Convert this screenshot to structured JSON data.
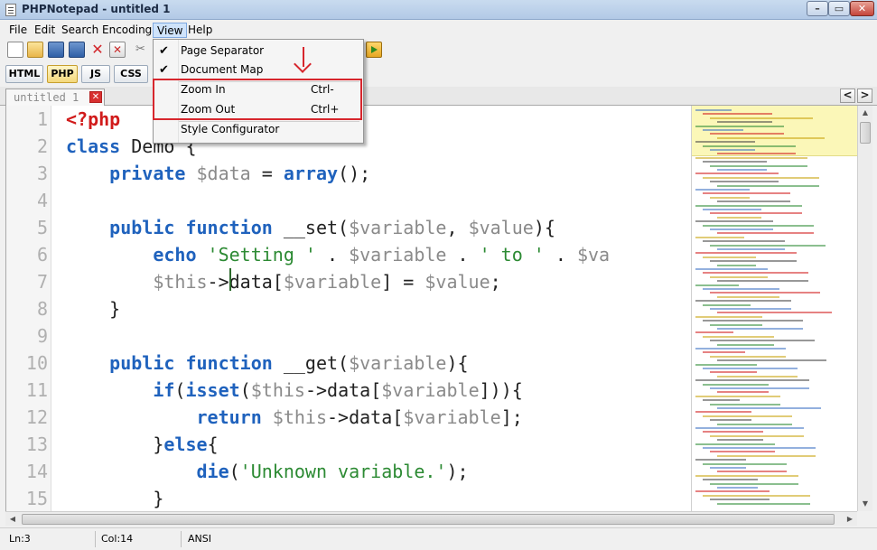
{
  "window": {
    "title": "PHPNotepad - untitled 1",
    "minimize": "–",
    "maximize": "▭",
    "close": "✕"
  },
  "menubar": [
    "File",
    "Edit",
    "Search",
    "Encoding",
    "View",
    "Help"
  ],
  "toolbar_icons": [
    "new-file-icon",
    "open-folder-icon",
    "save-icon",
    "save-all-icon",
    "close-icon",
    "close-all-icon",
    "cut-icon",
    "run-icon"
  ],
  "lang_tabs": [
    "HTML",
    "PHP",
    "JS",
    "CSS"
  ],
  "active_lang": "PHP",
  "doc_tab": {
    "label": "untitled 1",
    "close": "✕"
  },
  "tab_nav": {
    "prev": "<",
    "next": ">"
  },
  "line_numbers": [
    "1",
    "2",
    "3",
    "4",
    "5",
    "6",
    "7",
    "8",
    "9",
    "10",
    "11",
    "12",
    "13",
    "14",
    "15"
  ],
  "code_lines": [
    [
      {
        "t": "<?php",
        "c": "tag"
      }
    ],
    [
      {
        "t": "class",
        "c": "kw"
      },
      {
        "t": " Demo {",
        "c": ""
      }
    ],
    [
      {
        "t": "    ",
        "c": ""
      },
      {
        "t": "private",
        "c": "kw"
      },
      {
        "t": " ",
        "c": ""
      },
      {
        "t": "$data",
        "c": "var"
      },
      {
        "t": " = ",
        "c": ""
      },
      {
        "t": "array",
        "c": "kw"
      },
      {
        "t": "();",
        "c": ""
      }
    ],
    [],
    [
      {
        "t": "    ",
        "c": ""
      },
      {
        "t": "public",
        "c": "kw"
      },
      {
        "t": " ",
        "c": ""
      },
      {
        "t": "function",
        "c": "kw"
      },
      {
        "t": " __set(",
        "c": ""
      },
      {
        "t": "$variable",
        "c": "var"
      },
      {
        "t": ", ",
        "c": ""
      },
      {
        "t": "$value",
        "c": "var"
      },
      {
        "t": "){",
        "c": ""
      }
    ],
    [
      {
        "t": "        ",
        "c": ""
      },
      {
        "t": "echo",
        "c": "kw"
      },
      {
        "t": " ",
        "c": ""
      },
      {
        "t": "'Setting '",
        "c": "str"
      },
      {
        "t": " . ",
        "c": ""
      },
      {
        "t": "$variable",
        "c": "var"
      },
      {
        "t": " . ",
        "c": ""
      },
      {
        "t": "' to '",
        "c": "str"
      },
      {
        "t": " . ",
        "c": ""
      },
      {
        "t": "$va",
        "c": "var"
      }
    ],
    [
      {
        "t": "        ",
        "c": ""
      },
      {
        "t": "$this",
        "c": "var"
      },
      {
        "t": "->data[",
        "c": ""
      },
      {
        "t": "$variable",
        "c": "var"
      },
      {
        "t": "] = ",
        "c": ""
      },
      {
        "t": "$value",
        "c": "var"
      },
      {
        "t": ";",
        "c": ""
      }
    ],
    [
      {
        "t": "    }",
        "c": ""
      }
    ],
    [],
    [
      {
        "t": "    ",
        "c": ""
      },
      {
        "t": "public",
        "c": "kw"
      },
      {
        "t": " ",
        "c": ""
      },
      {
        "t": "function",
        "c": "kw"
      },
      {
        "t": " __get(",
        "c": ""
      },
      {
        "t": "$variable",
        "c": "var"
      },
      {
        "t": "){",
        "c": ""
      }
    ],
    [
      {
        "t": "        ",
        "c": ""
      },
      {
        "t": "if",
        "c": "kw"
      },
      {
        "t": "(",
        "c": ""
      },
      {
        "t": "isset",
        "c": "kw"
      },
      {
        "t": "(",
        "c": ""
      },
      {
        "t": "$this",
        "c": "var"
      },
      {
        "t": "->data[",
        "c": ""
      },
      {
        "t": "$variable",
        "c": "var"
      },
      {
        "t": "])){",
        "c": ""
      }
    ],
    [
      {
        "t": "            ",
        "c": ""
      },
      {
        "t": "return",
        "c": "kw"
      },
      {
        "t": " ",
        "c": ""
      },
      {
        "t": "$this",
        "c": "var"
      },
      {
        "t": "->data[",
        "c": ""
      },
      {
        "t": "$variable",
        "c": "var"
      },
      {
        "t": "];",
        "c": ""
      }
    ],
    [
      {
        "t": "        }",
        "c": ""
      },
      {
        "t": "else",
        "c": "kw"
      },
      {
        "t": "{",
        "c": ""
      }
    ],
    [
      {
        "t": "            ",
        "c": ""
      },
      {
        "t": "die",
        "c": "kw"
      },
      {
        "t": "(",
        "c": ""
      },
      {
        "t": "'Unknown variable.'",
        "c": "str"
      },
      {
        "t": ");",
        "c": ""
      }
    ],
    [
      {
        "t": "        }",
        "c": ""
      }
    ]
  ],
  "view_menu": {
    "items": [
      {
        "label": "Page Separator",
        "checked": true,
        "shortcut": ""
      },
      {
        "label": "Document Map",
        "checked": true,
        "shortcut": ""
      },
      {
        "label": "Zoom In",
        "checked": false,
        "shortcut": "Ctrl-"
      },
      {
        "label": "Zoom Out",
        "checked": false,
        "shortcut": "Ctrl+"
      },
      {
        "label": "Style Configurator",
        "checked": false,
        "shortcut": ""
      }
    ],
    "check_glyph": "✔"
  },
  "scrollbar": {
    "up": "▲",
    "down": "▼",
    "left": "◀",
    "right": "▶"
  },
  "status": {
    "line": "Ln:3",
    "col": "Col:14",
    "encoding": "ANSI"
  },
  "colors": {
    "accent": "#1f62bd",
    "string": "#2c8a33",
    "php_tag": "#d11b1b",
    "highlight": "#d7262d"
  }
}
